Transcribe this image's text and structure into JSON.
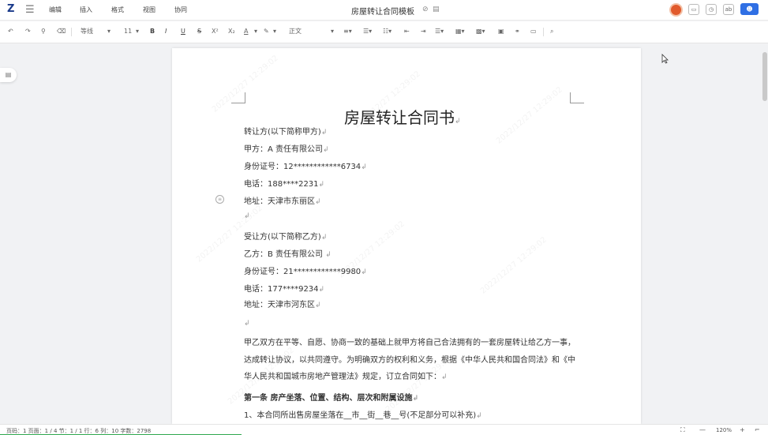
{
  "menubar": {
    "logo": "Z",
    "items": [
      "编辑",
      "插入",
      "格式",
      "视图",
      "协同"
    ],
    "doc_title": "房屋转让合同模板"
  },
  "toolbar": {
    "font_name": "等线",
    "font_size": "11",
    "style": "正文",
    "bold": "B",
    "italic": "I",
    "underline": "U",
    "strike": "S",
    "superscript": "X²",
    "subscript": "X₂",
    "font_color": "A"
  },
  "document": {
    "title": "房屋转让合同书",
    "lines": [
      "转让方(以下简称甲方)",
      "甲方：A 责任有限公司",
      "身份证号：12************6734",
      "电话：188****2231",
      "地址：天津市东丽区",
      "",
      "受让方(以下简称乙方)",
      "乙方：B 责任有限公司 ",
      "身份证号：21************9980",
      "电话：177****9234",
      "地址：天津市河东区",
      ""
    ],
    "body": "甲乙双方在平等、自愿、协商一致的基础上就甲方将自己合法拥有的一套房屋转让给乙方一事，达成转让协议，以共同遵守。为明确双方的权利和义务，根据《中华人民共和国合同法》和《中华人民共和国城市房地产管理法》规定，订立合同如下：",
    "section1_title": "第一条  房产坐落、位置、结构、层次和附属设施",
    "section1_line1": "1、本合同所出售房屋坐落在__市__街__巷__号(不足部分可以补充)",
    "para_mark": "↲"
  },
  "statusbar": {
    "text": "页码：1  页面：1 / 4    节：1 / 1  行：6  列：10  字数：2798",
    "zoom": "120%",
    "zoom_out": "—",
    "zoom_in": "+"
  }
}
